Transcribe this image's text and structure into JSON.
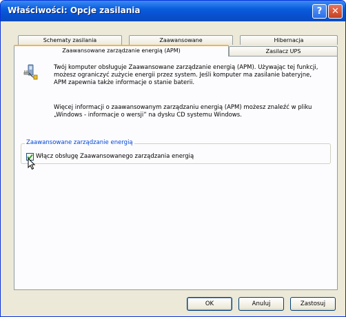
{
  "window": {
    "title": "Właściwości: Opcje zasilania",
    "help_glyph": "?",
    "close_glyph": "✕"
  },
  "tabs": {
    "row1": [
      "Schematy zasilania",
      "Zaawansowane",
      "Hibernacja"
    ],
    "row2": [
      "Zaawansowane zarządzanie energią (APM)",
      "Zasilacz UPS"
    ],
    "active": "Zaawansowane zarządzanie energią (APM)"
  },
  "apm": {
    "icon": "power-management-icon",
    "paragraph1": "Twój komputer obsługuje Zaawansowane zarządzanie energią (APM). Używając tej funkcji, możesz ograniczyć zużycie energii przez system. Jeśli komputer ma zasilanie bateryjne, APM zapewnia także informacje o stanie baterii.",
    "paragraph2": "Więcej informacji o zaawansowanym zarządzaniu energią (APM) możesz znaleźć w pliku „Windows - informacje o wersji” na dysku CD systemu Windows.",
    "group_title": "Zaawansowane zarządzanie energią",
    "checkbox_label": "Włącz obsługę Zaawansowanego zarządzania energią",
    "checkbox_checked": true
  },
  "buttons": {
    "ok": "OK",
    "cancel": "Anuluj",
    "apply": "Zastosuj"
  },
  "colors": {
    "titlebar": "#0a5ddc",
    "active_tab_accent": "#f9b33c",
    "group_title": "#0046d5",
    "checkmark": "#21a121"
  }
}
